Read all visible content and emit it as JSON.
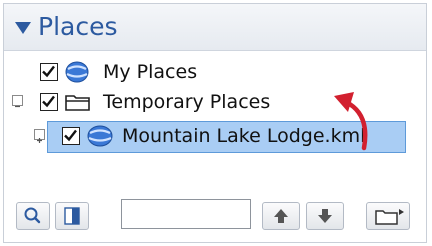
{
  "panel": {
    "title": "Places",
    "items": [
      {
        "label": "My Places",
        "checked": true,
        "icon": "globe-icon"
      },
      {
        "label": "Temporary Places",
        "checked": true,
        "icon": "folder-icon",
        "expanded": true
      },
      {
        "label": "Mountain Lake Lodge.kml",
        "checked": true,
        "icon": "globe-icon",
        "selected": true
      }
    ]
  },
  "toolbar": {
    "search_value": "",
    "buttons": [
      "search-icon",
      "panel-toggle-icon",
      "move-up-icon",
      "move-down-icon",
      "folder-menu-icon"
    ]
  },
  "colors": {
    "accent": "#2c5aa0",
    "selection": "#a9cdf4",
    "annotation_arrow": "#d2202f"
  }
}
